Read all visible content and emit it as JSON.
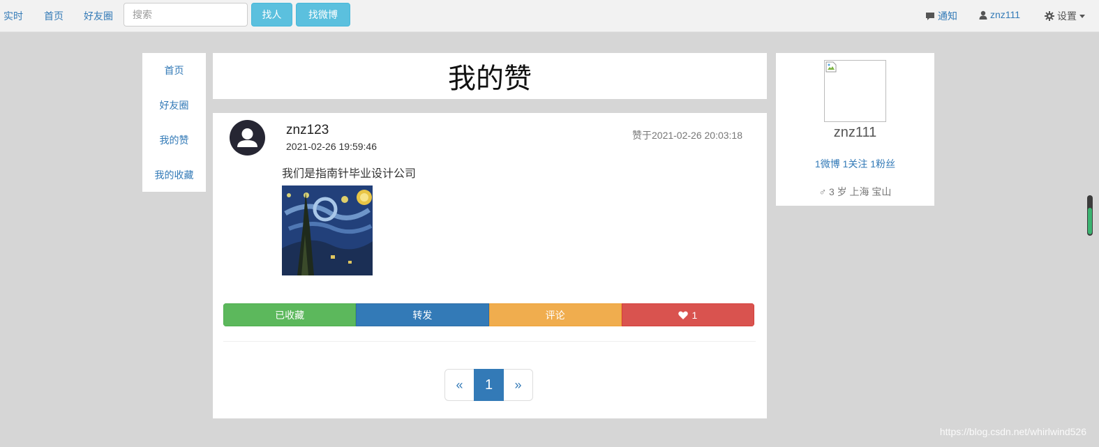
{
  "navbar": {
    "links": [
      "实时",
      "首页",
      "好友圈"
    ],
    "search_placeholder": "搜索",
    "find_people": "找人",
    "find_weibo": "找微博",
    "notify": "通知",
    "username": "znz111",
    "settings": "设置"
  },
  "left_menu": {
    "items": [
      "首页",
      "好友圈",
      "我的赞",
      "我的收藏"
    ]
  },
  "page_title": "我的赞",
  "post": {
    "author": "znz123",
    "time": "2021-02-26 19:59:46",
    "liked_at": "赞于2021-02-26 20:03:18",
    "text": "我们是指南针毕业设计公司",
    "actions": {
      "collected": "已收藏",
      "forward": "转发",
      "comment": "评论",
      "likes": "1"
    }
  },
  "pagination": {
    "prev": "«",
    "current": "1",
    "next": "»"
  },
  "profile": {
    "name": "znz111",
    "weibo_count": "1微博",
    "follow_count": "1关注",
    "fans_count": "1粉丝",
    "info": "♂ 3 岁 上海 宝山"
  },
  "watermark": "https://blog.csdn.net/whirlwind526",
  "colors": {
    "primary": "#337ab7",
    "info": "#5bc0de",
    "success": "#5cb85c",
    "warning": "#f0ad4e",
    "danger": "#d9534f",
    "background": "#d6d6d6"
  }
}
